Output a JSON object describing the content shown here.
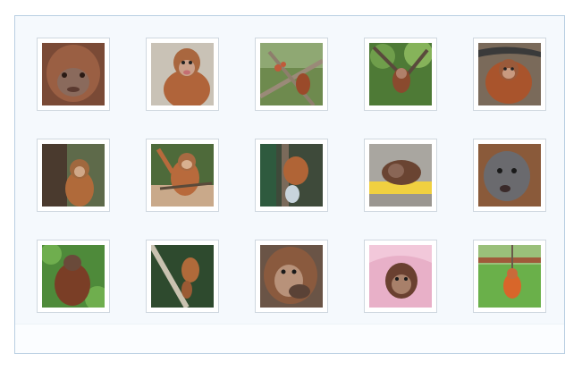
{
  "gallery": {
    "rows": 3,
    "columns": 5,
    "items": [
      {
        "subject": "orangutan-infant-face-closeup"
      },
      {
        "subject": "orangutan-infant-sitting"
      },
      {
        "subject": "orangutan-in-tree-branches"
      },
      {
        "subject": "orangutan-hanging-green-tree"
      },
      {
        "subject": "orangutan-climbing-branches"
      },
      {
        "subject": "orangutan-infant-held-by-adult"
      },
      {
        "subject": "orangutan-infant-arms-raised"
      },
      {
        "subject": "orangutan-infant-climbing-post"
      },
      {
        "subject": "orangutan-infant-resting-yellow-blanket"
      },
      {
        "subject": "orangutan-face-tilted"
      },
      {
        "subject": "adult-orangutan-green-foliage"
      },
      {
        "subject": "orangutan-climbing-rope"
      },
      {
        "subject": "orangutan-face-hand-to-mouth"
      },
      {
        "subject": "orangutan-infant-pink-towel"
      },
      {
        "subject": "orangutan-on-grass-lawn"
      }
    ]
  }
}
